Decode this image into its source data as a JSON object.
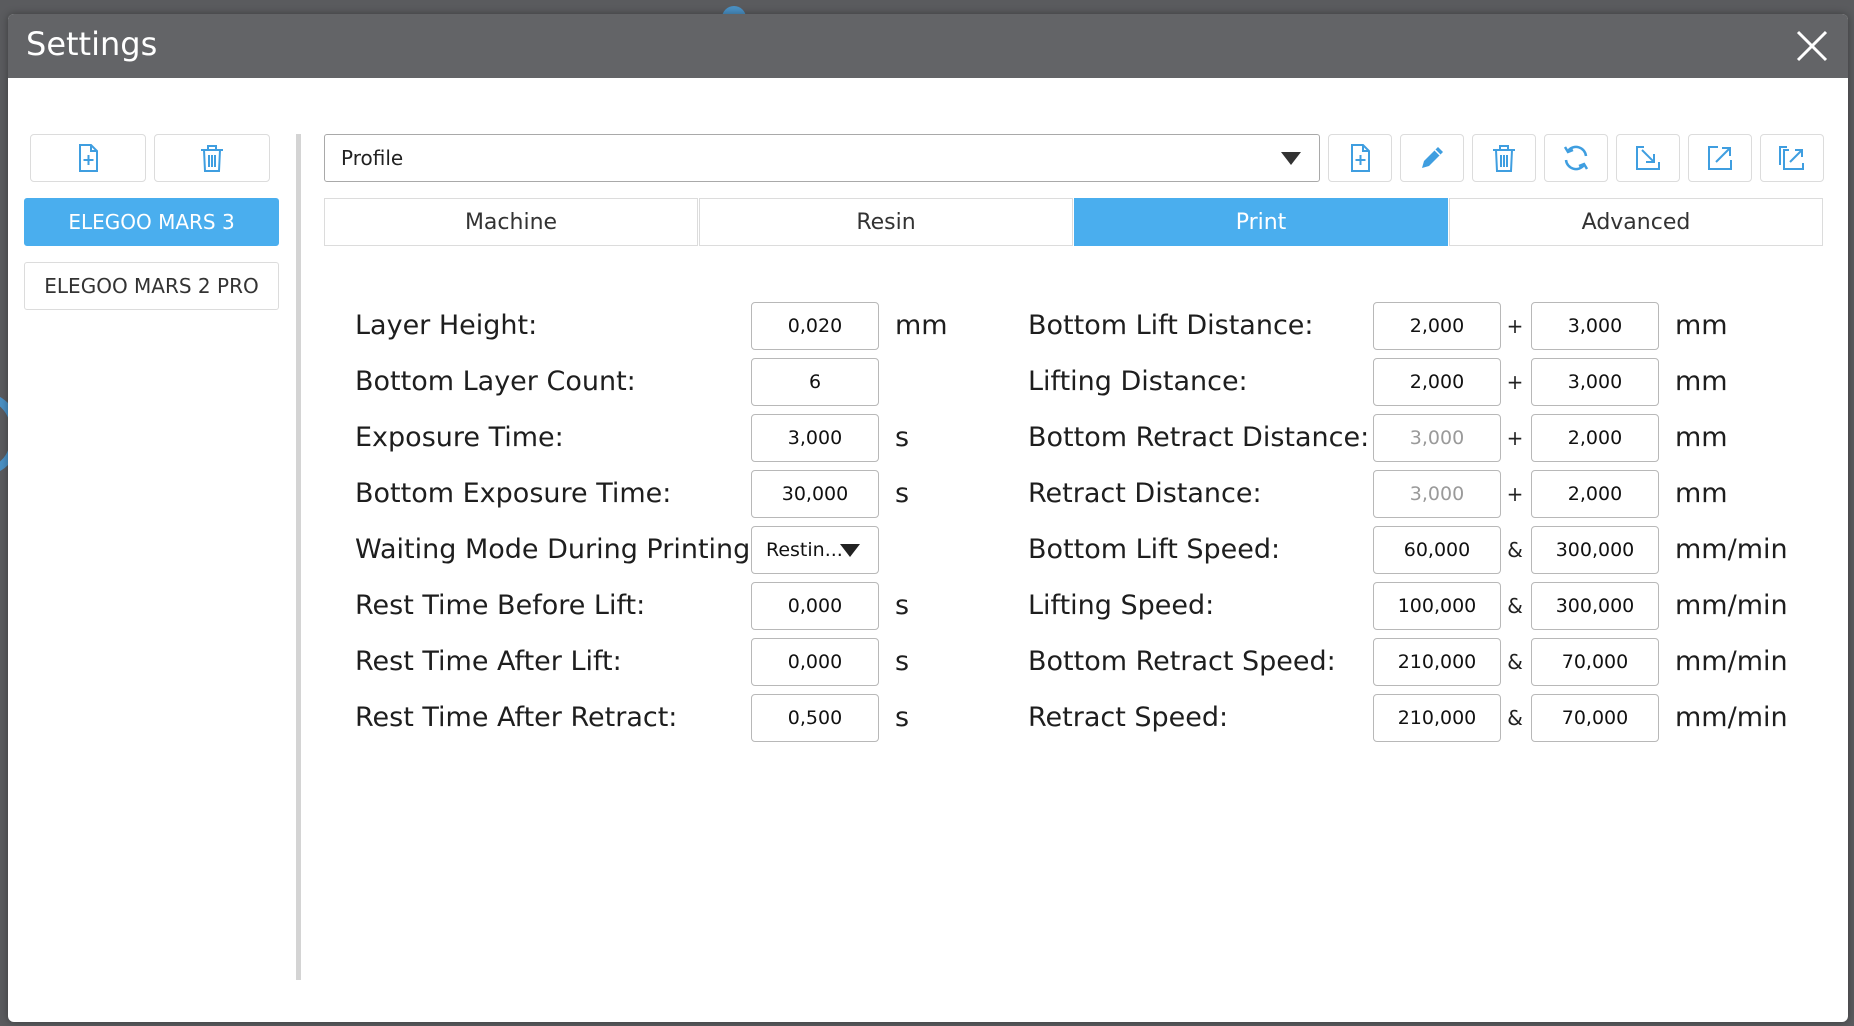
{
  "window": {
    "title": "Settings"
  },
  "sidebar": {
    "printers": [
      {
        "label": "ELEGOO MARS 3",
        "active": true
      },
      {
        "label": "ELEGOO MARS 2 PRO",
        "active": false
      }
    ]
  },
  "profile": {
    "selected": "Profile"
  },
  "tabs": [
    {
      "label": "Machine",
      "active": false
    },
    {
      "label": "Resin",
      "active": false
    },
    {
      "label": "Print",
      "active": true
    },
    {
      "label": "Advanced",
      "active": false
    }
  ],
  "left_settings": [
    {
      "label": "Layer Height:",
      "value": "0,020",
      "unit": "mm"
    },
    {
      "label": "Bottom Layer Count:",
      "value": "6",
      "unit": ""
    },
    {
      "label": "Exposure Time:",
      "value": "3,000",
      "unit": "s"
    },
    {
      "label": "Bottom Exposure Time:",
      "value": "30,000",
      "unit": "s"
    },
    {
      "label": "Waiting Mode During Printing:",
      "value": "Restin...",
      "unit": ""
    },
    {
      "label": "Rest Time Before Lift:",
      "value": "0,000",
      "unit": "s"
    },
    {
      "label": "Rest Time After Lift:",
      "value": "0,000",
      "unit": "s"
    },
    {
      "label": "Rest Time After Retract:",
      "value": "0,500",
      "unit": "s"
    }
  ],
  "right_settings": [
    {
      "label": "Bottom Lift Distance:",
      "value1": "2,000",
      "op": "+",
      "value2": "3,000",
      "unit": "mm"
    },
    {
      "label": "Lifting Distance:",
      "value1": "2,000",
      "op": "+",
      "value2": "3,000",
      "unit": "mm"
    },
    {
      "label": "Bottom Retract Distance:",
      "value1": "3,000",
      "op": "+",
      "value2": "2,000",
      "unit": "mm"
    },
    {
      "label": "Retract Distance:",
      "value1": "3,000",
      "op": "+",
      "value2": "2,000",
      "unit": "mm"
    },
    {
      "label": "Bottom Lift Speed:",
      "value1": "60,000",
      "op": "&",
      "value2": "300,000",
      "unit": "mm/min"
    },
    {
      "label": "Lifting Speed:",
      "value1": "100,000",
      "op": "&",
      "value2": "300,000",
      "unit": "mm/min"
    },
    {
      "label": "Bottom Retract Speed:",
      "value1": "210,000",
      "op": "&",
      "value2": "70,000",
      "unit": "mm/min"
    },
    {
      "label": "Retract Speed:",
      "value1": "210,000",
      "op": "&",
      "value2": "70,000",
      "unit": "mm/min"
    }
  ],
  "colors": {
    "accent": "#4aaeee",
    "icon": "#3f9ee0",
    "titlebar": "#636467"
  }
}
